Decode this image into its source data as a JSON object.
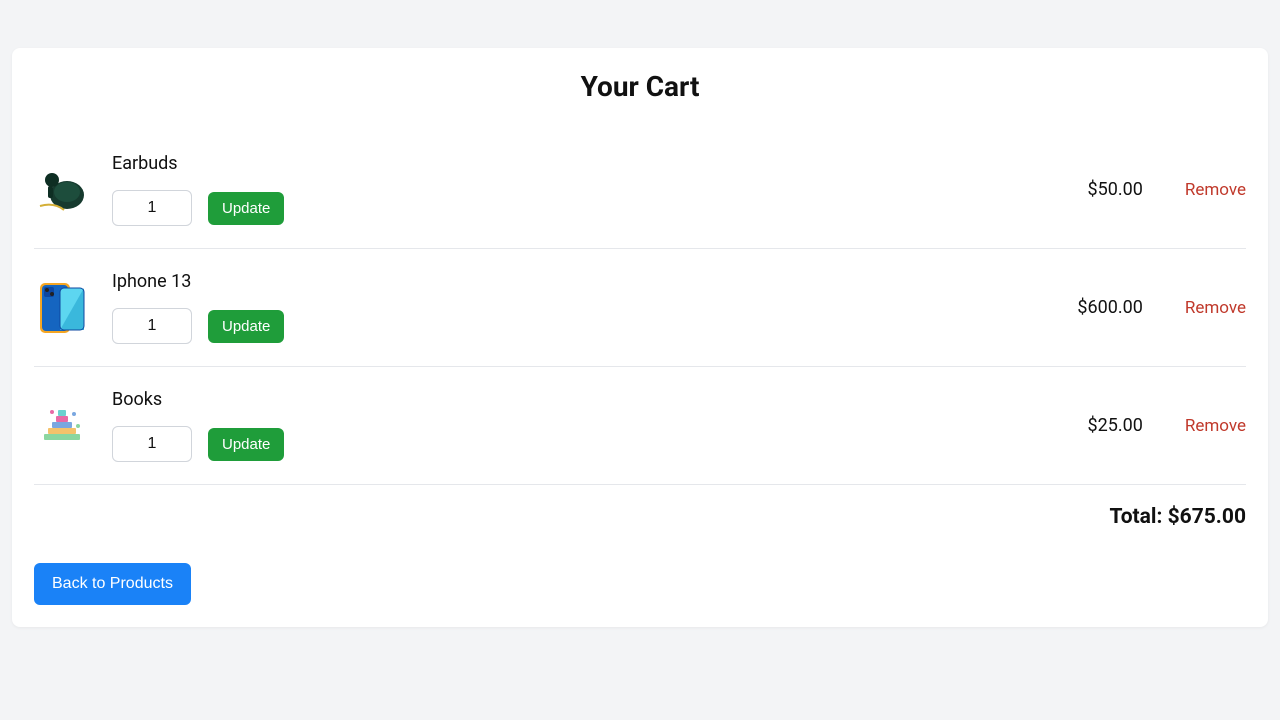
{
  "header": {
    "title": "Your Cart"
  },
  "items": [
    {
      "name": "Earbuds",
      "quantity": "1",
      "price": "$50.00",
      "update_label": "Update",
      "remove_label": "Remove",
      "icon": "earbuds"
    },
    {
      "name": "Iphone 13",
      "quantity": "1",
      "price": "$600.00",
      "update_label": "Update",
      "remove_label": "Remove",
      "icon": "phone"
    },
    {
      "name": "Books",
      "quantity": "1",
      "price": "$25.00",
      "update_label": "Update",
      "remove_label": "Remove",
      "icon": "books"
    }
  ],
  "total": {
    "label": "Total: ",
    "amount": "$675.00"
  },
  "actions": {
    "back_label": "Back to Products"
  }
}
